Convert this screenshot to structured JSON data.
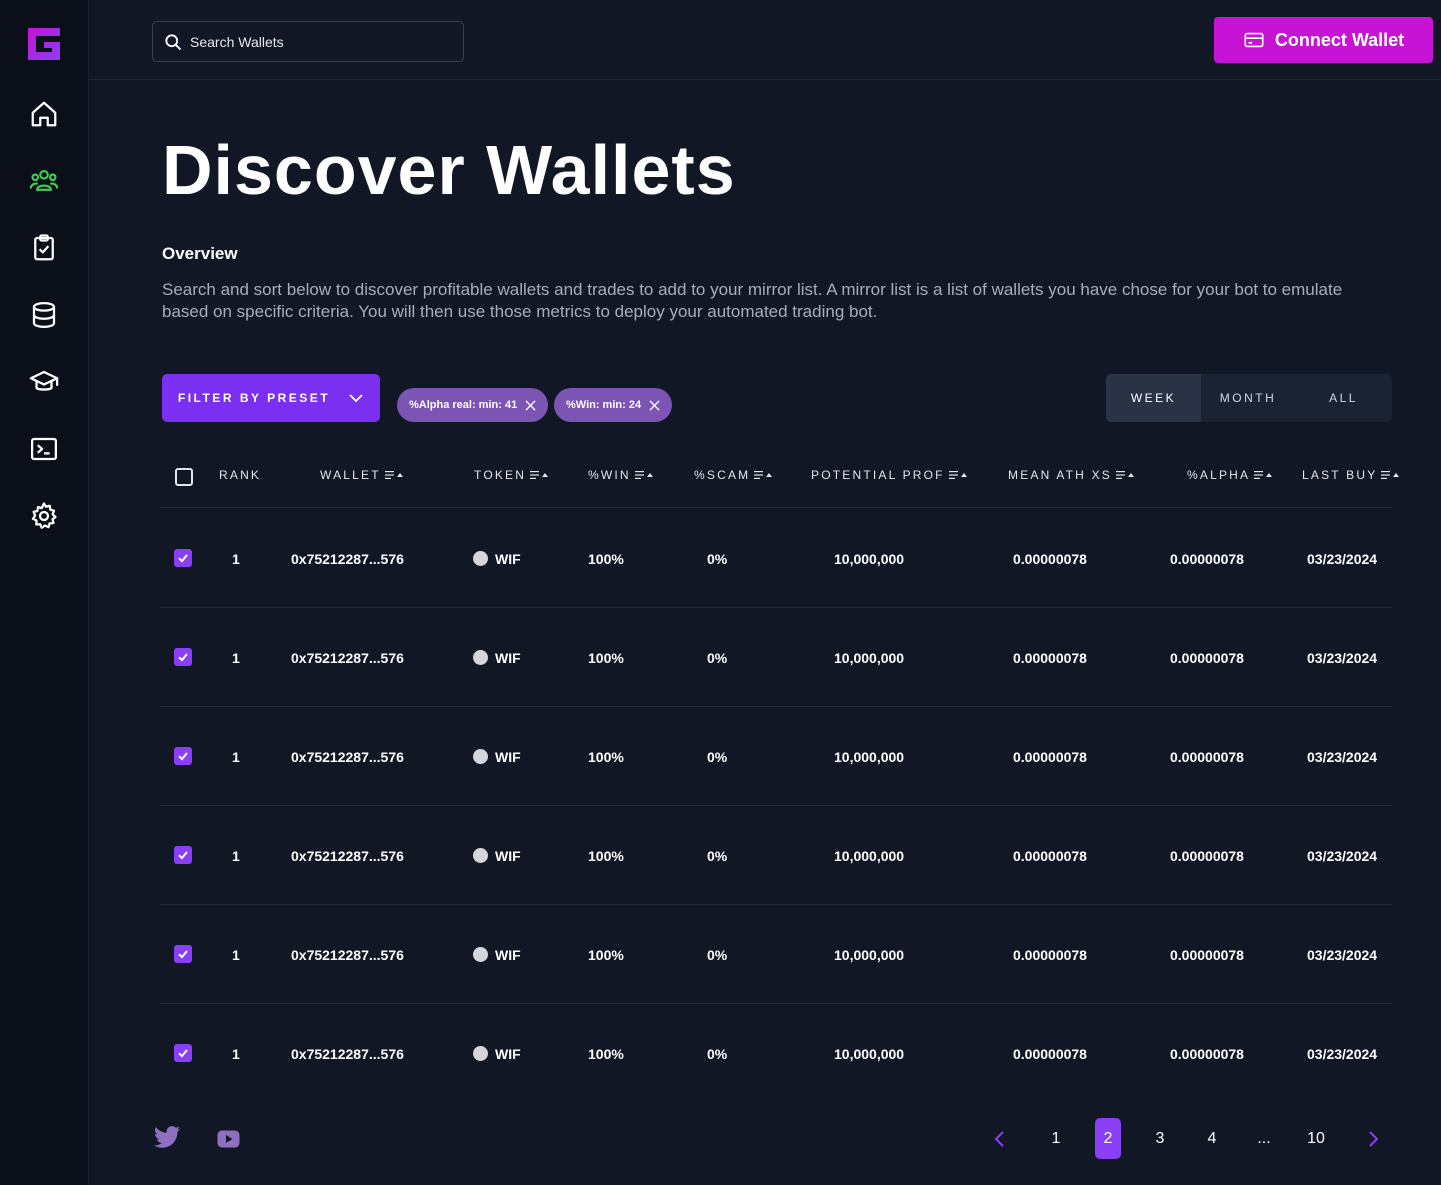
{
  "app": {
    "logo": "G"
  },
  "sidebar": {
    "items": [
      {
        "icon": "home-icon",
        "active": false
      },
      {
        "icon": "users-icon",
        "active": true
      },
      {
        "icon": "clipboard-check-icon",
        "active": false
      },
      {
        "icon": "database-icon",
        "active": false
      },
      {
        "icon": "graduation-cap-icon",
        "active": false
      },
      {
        "icon": "terminal-icon",
        "active": false
      },
      {
        "icon": "gear-icon",
        "active": false
      }
    ]
  },
  "header": {
    "search_placeholder": "Search Wallets",
    "connect_label": "Connect Wallet"
  },
  "page": {
    "title": "Discover Wallets",
    "overview_heading": "Overview",
    "overview_text": "Search and sort below to discover profitable wallets and trades to add to your mirror list. A mirror list is a list of wallets you have chose for your bot to emulate based on specific criteria. You will then use those metrics to deploy your automated trading bot."
  },
  "filters": {
    "preset_label": "FILTER BY PRESET",
    "chips": [
      "%Alpha real: min: 41",
      "%Win: min: 24"
    ],
    "periods": [
      "WEEK",
      "MONTH",
      "ALL"
    ],
    "active_period": "WEEK"
  },
  "table": {
    "columns": [
      "RANK",
      "WALLET",
      "TOKEN",
      "%WIN",
      "%SCAM",
      "POTENTIAL PROF",
      "MEAN ATH XS",
      "%ALPHA",
      "LAST BUY"
    ],
    "rows": [
      {
        "checked": true,
        "rank": "1",
        "wallet": "0x75212287...576",
        "token": "WIF",
        "win": "100%",
        "scam": "0%",
        "potential": "10,000,000",
        "mean_ath": "0.00000078",
        "alpha": "0.00000078",
        "last_buy": "03/23/2024"
      },
      {
        "checked": true,
        "rank": "1",
        "wallet": "0x75212287...576",
        "token": "WIF",
        "win": "100%",
        "scam": "0%",
        "potential": "10,000,000",
        "mean_ath": "0.00000078",
        "alpha": "0.00000078",
        "last_buy": "03/23/2024"
      },
      {
        "checked": true,
        "rank": "1",
        "wallet": "0x75212287...576",
        "token": "WIF",
        "win": "100%",
        "scam": "0%",
        "potential": "10,000,000",
        "mean_ath": "0.00000078",
        "alpha": "0.00000078",
        "last_buy": "03/23/2024"
      },
      {
        "checked": true,
        "rank": "1",
        "wallet": "0x75212287...576",
        "token": "WIF",
        "win": "100%",
        "scam": "0%",
        "potential": "10,000,000",
        "mean_ath": "0.00000078",
        "alpha": "0.00000078",
        "last_buy": "03/23/2024"
      },
      {
        "checked": true,
        "rank": "1",
        "wallet": "0x75212287...576",
        "token": "WIF",
        "win": "100%",
        "scam": "0%",
        "potential": "10,000,000",
        "mean_ath": "0.00000078",
        "alpha": "0.00000078",
        "last_buy": "03/23/2024"
      },
      {
        "checked": true,
        "rank": "1",
        "wallet": "0x75212287...576",
        "token": "WIF",
        "win": "100%",
        "scam": "0%",
        "potential": "10,000,000",
        "mean_ath": "0.00000078",
        "alpha": "0.00000078",
        "last_buy": "03/23/2024"
      }
    ]
  },
  "pagination": {
    "pages": [
      "1",
      "2",
      "3",
      "4",
      "...",
      "10"
    ],
    "current": "2"
  },
  "footer": {
    "social": [
      "twitter-icon",
      "youtube-icon"
    ]
  },
  "colors": {
    "accent": "#8a3ef5",
    "connect": "#c613d6",
    "active_nav": "#39d353",
    "background": "#121726",
    "sidebar": "#0b0f1a"
  }
}
